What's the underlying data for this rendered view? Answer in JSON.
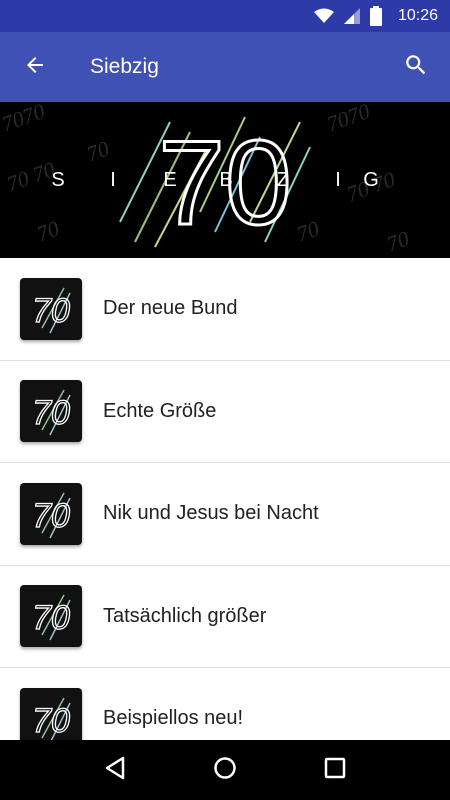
{
  "status_bar": {
    "time": "10:26",
    "icons": [
      "wifi-icon",
      "signal-icon",
      "battery-icon"
    ]
  },
  "app_bar": {
    "title": "Siebzig",
    "back_icon": "arrow-back-icon",
    "search_icon": "search-icon",
    "color": "#3f51b5",
    "status_color": "#2d3aa8"
  },
  "banner": {
    "number": "70",
    "letters": [
      "S",
      "I",
      "E",
      "B",
      "Z",
      "I",
      "G"
    ]
  },
  "thumb": {
    "number": "70"
  },
  "list": {
    "items": [
      {
        "label": "Der neue Bund"
      },
      {
        "label": "Echte Größe"
      },
      {
        "label": "Nik und Jesus bei Nacht"
      },
      {
        "label": "Tatsächlich größer"
      },
      {
        "label": "Beispiellos neu!"
      }
    ]
  },
  "nav_bar": {
    "icons": [
      "back-triangle-icon",
      "home-circle-icon",
      "recents-square-icon"
    ]
  }
}
